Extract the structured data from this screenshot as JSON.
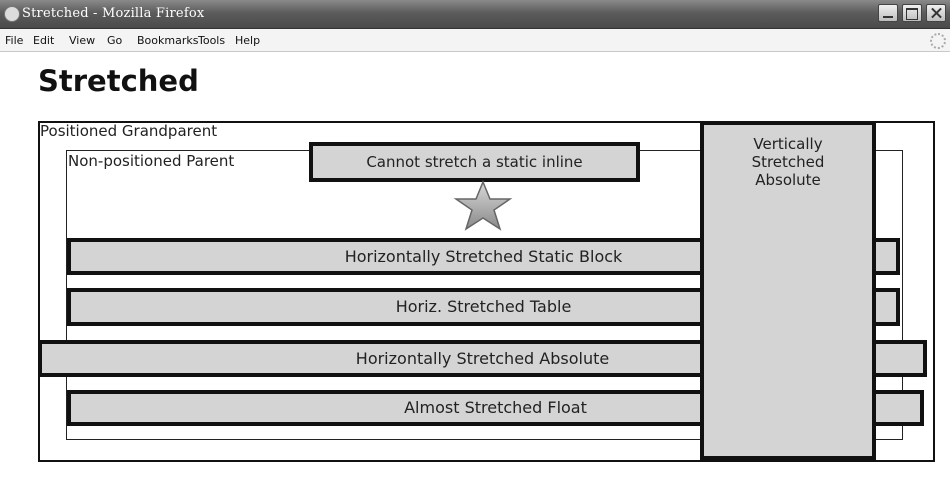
{
  "window": {
    "title": "Stretched - Mozilla Firefox",
    "icons": [
      "firefox-icon",
      "minimize-icon",
      "maximize-icon",
      "close-icon",
      "throbber-icon"
    ]
  },
  "menu": {
    "file": "File",
    "edit": "Edit",
    "view": "View",
    "go": "Go",
    "bookmarks": "Bookmarks",
    "tools": "Tools",
    "help": "Help"
  },
  "page": {
    "heading": "Stretched",
    "grandparent_label": "Positioned Grandparent",
    "parent_label": "Non-positioned Parent",
    "static_inline": "Cannot stretch a static inline",
    "star_icon": "star-icon",
    "static_block": "Horizontally Stretched Static Block",
    "table": "Horiz. Stretched Table",
    "absolute": "Horizontally Stretched Absolute",
    "float": "Almost Stretched Float",
    "vertical_abs": [
      "Vertically",
      "Stretched",
      "Absolute"
    ]
  },
  "colors": {
    "box_fill": "#d4d4d4",
    "border": "#111111",
    "titlebar": "#5c5c5c"
  }
}
